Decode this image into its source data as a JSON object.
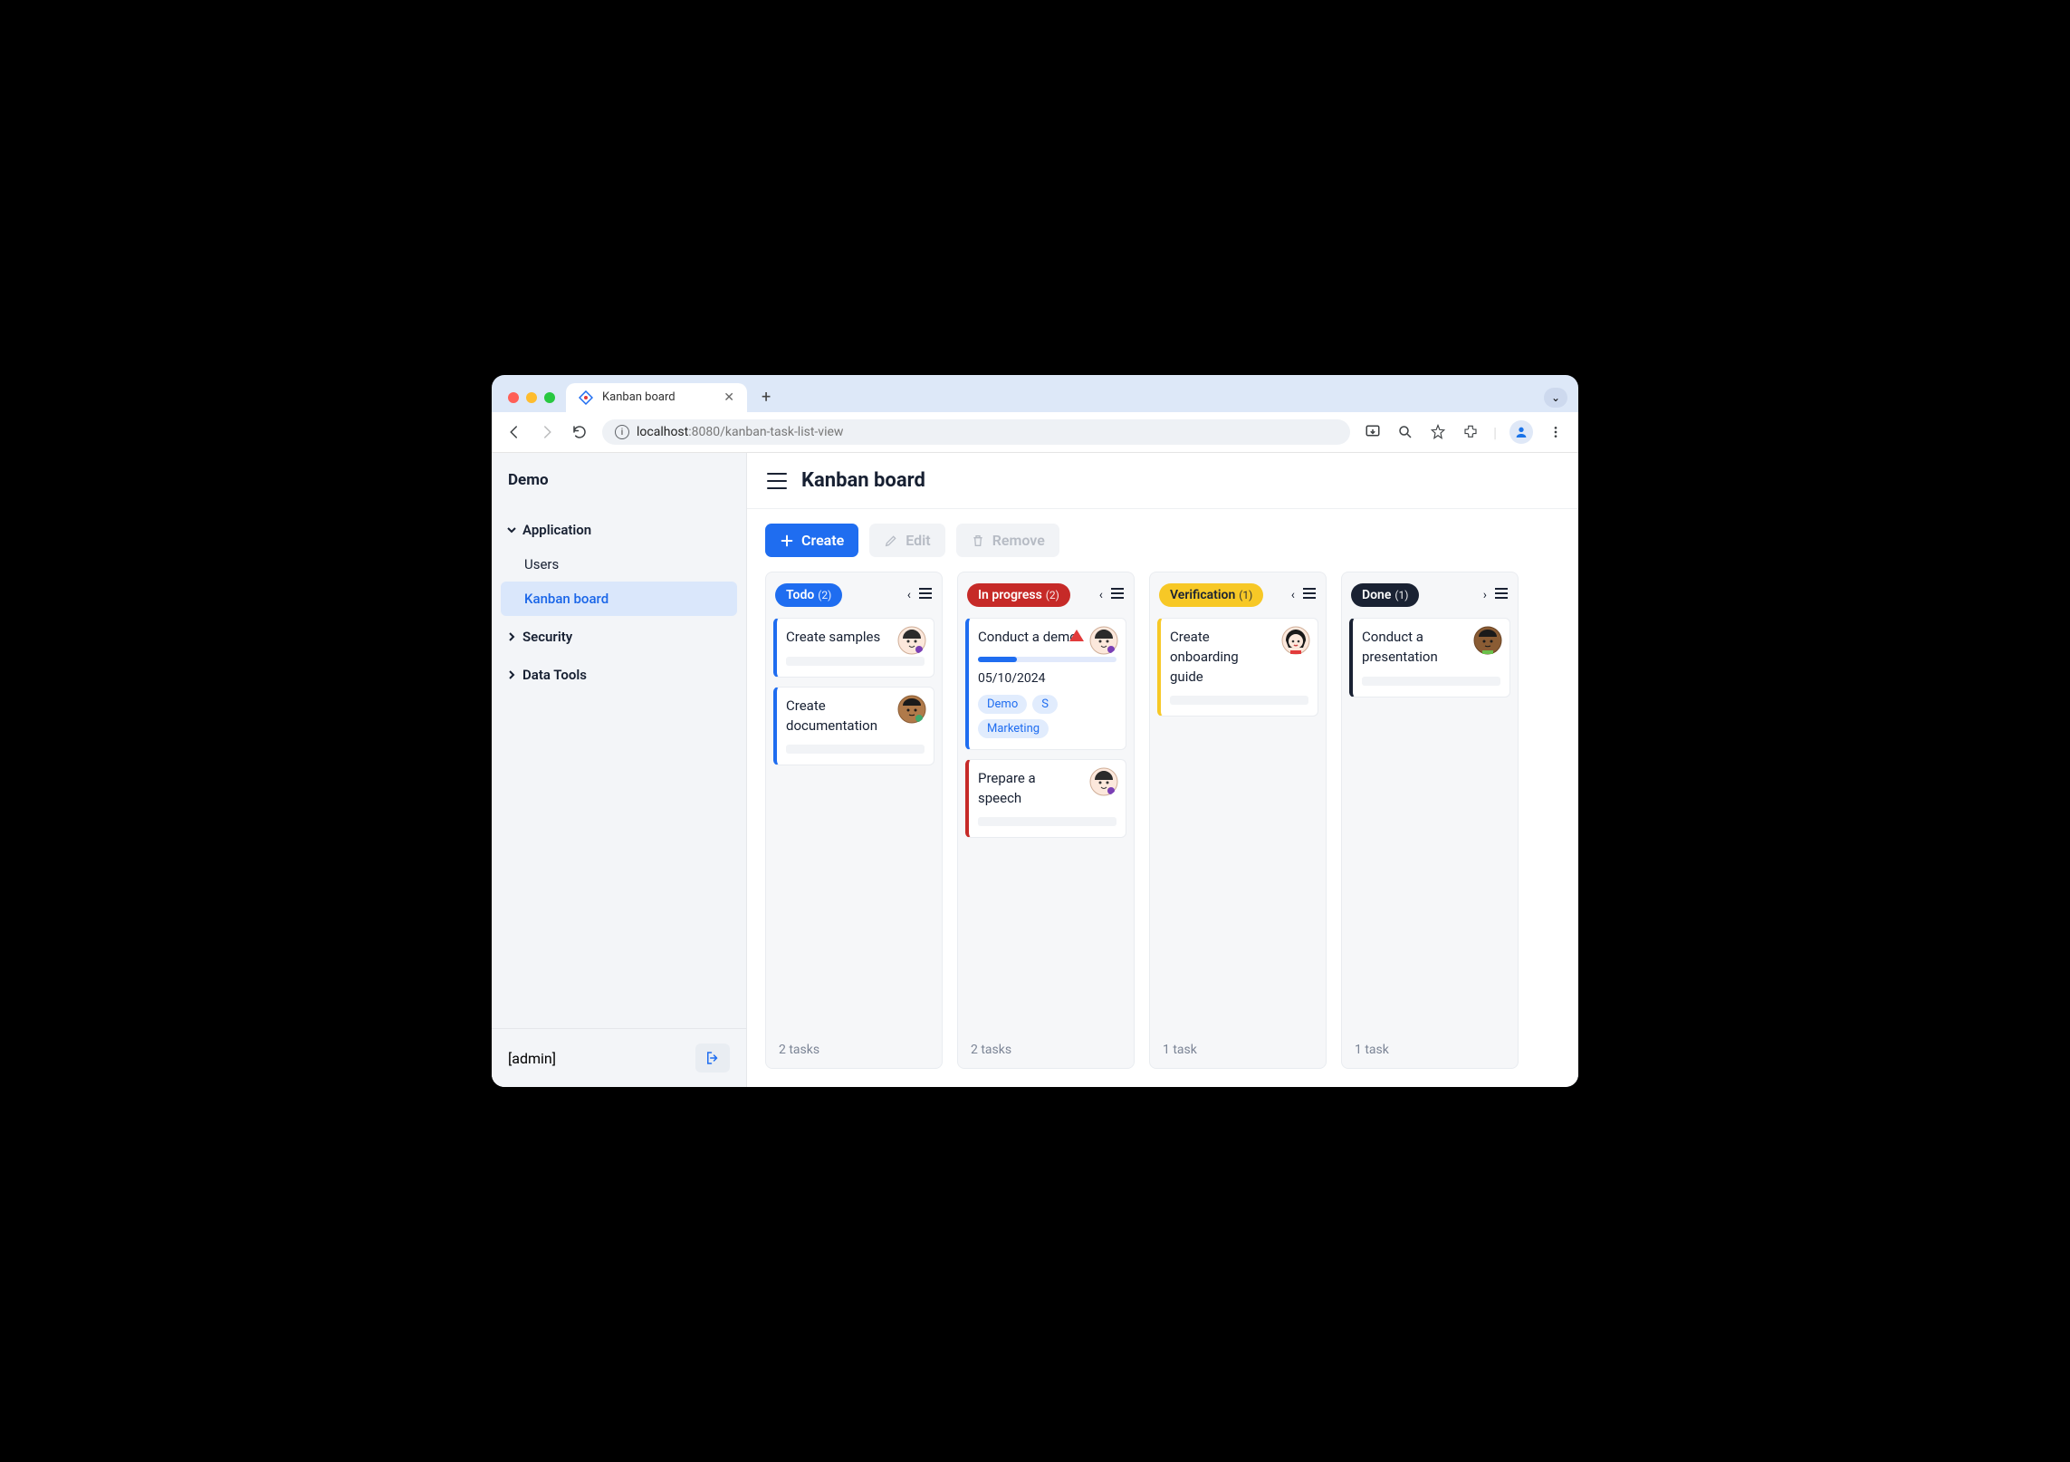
{
  "browser": {
    "tab_title": "Kanban board",
    "url_host": "localhost",
    "url_port": ":8080",
    "url_path": "/kanban-task-list-view"
  },
  "sidebar": {
    "title": "Demo",
    "groups": [
      {
        "label": "Application",
        "expanded": true,
        "items": [
          {
            "label": "Users",
            "active": false
          },
          {
            "label": "Kanban board",
            "active": true
          }
        ]
      },
      {
        "label": "Security",
        "expanded": false,
        "items": []
      },
      {
        "label": "Data Tools",
        "expanded": false,
        "items": []
      }
    ],
    "footer_user": "[admin]"
  },
  "header": {
    "title": "Kanban board"
  },
  "actions": {
    "create": "Create",
    "edit": "Edit",
    "remove": "Remove"
  },
  "columns": [
    {
      "name": "Todo",
      "count": "(2)",
      "color": "#1f6df0",
      "border": "#1f6df0",
      "nav_left": false,
      "nav_right": false,
      "prev": true,
      "cards": [
        {
          "title": "Create samples",
          "assignee": "av1"
        },
        {
          "title": "Create documentation",
          "assignee": "av2"
        }
      ],
      "footer": "2 tasks"
    },
    {
      "name": "In progress",
      "count": "(2)",
      "color": "#c62a28",
      "border_map": [
        "#1f6df0",
        "#c62a28"
      ],
      "nav_left": true,
      "nav_right": false,
      "cards": [
        {
          "title": "Conduct a demo",
          "assignee": "av1",
          "flag": true,
          "progress": 28,
          "date": "05/10/2024",
          "tags": [
            "Demo",
            "S",
            "Marketing"
          ],
          "border": "#1f6df0"
        },
        {
          "title": "Prepare a speech",
          "assignee": "av1",
          "border": "#c62a28"
        }
      ],
      "footer": "2 tasks"
    },
    {
      "name": "Verification",
      "count": "(1)",
      "color": "#f7c826",
      "text_dark": true,
      "nav_left": true,
      "nav_right": false,
      "cards": [
        {
          "title": "Create onboarding guide",
          "assignee": "av3",
          "border": "#f7c826"
        }
      ],
      "footer": "1 task"
    },
    {
      "name": "Done",
      "count": "(1)",
      "color": "#1a2233",
      "nav_left": false,
      "nav_right": true,
      "cards": [
        {
          "title": "Conduct a presentation",
          "assignee": "av4",
          "border": "#1a2233"
        }
      ],
      "footer": "1 task"
    }
  ]
}
